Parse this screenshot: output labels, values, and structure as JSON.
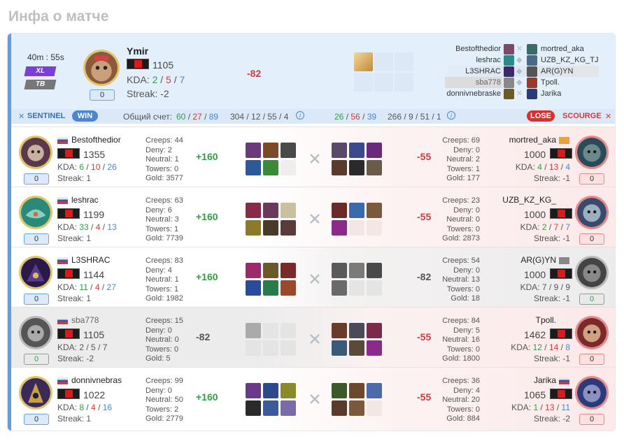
{
  "page_title": "Инфа о матче",
  "match": {
    "duration": "40m : 55s",
    "tags": [
      "XL",
      "TB"
    ],
    "player": {
      "name": "Ymir",
      "mmr": "1105",
      "kda": {
        "k": "2",
        "d": "5",
        "a": "7"
      },
      "kda_label": "KDA:",
      "streak": "Streak: -2",
      "badge": "0"
    },
    "delta": "-82",
    "matchups": [
      {
        "left": "Bestofthedior",
        "right": "mortred_aka"
      },
      {
        "left": "leshrac",
        "right": "UZB_KZ_KG_TJ"
      },
      {
        "left": "L3SHRAC",
        "right": "AR(G)YN"
      },
      {
        "left": "sba778",
        "right": "Tpoll."
      },
      {
        "left": "donnivnebraske",
        "right": "Jarika"
      }
    ]
  },
  "bar": {
    "sentinel": "SENTINEL",
    "win": "WIN",
    "score_label": "Общий счет:",
    "left_score": {
      "a": "60",
      "b": "27",
      "c": "89"
    },
    "left_totals": "304 / 12 / 55 / 4",
    "right_score": {
      "a": "26",
      "b": "56",
      "c": "39"
    },
    "right_totals": "266 / 9 / 51 / 1",
    "lose": "LOSE",
    "scourge": "SCOURGE"
  },
  "rows": [
    {
      "l": {
        "name": "Bestofthedior",
        "mmr": "1355",
        "k": "6",
        "d": "10",
        "a": "26",
        "streak": "Streak: 1",
        "badge": "0",
        "creeps": "Creeps: 44",
        "deny": "Deny: 2",
        "neutral": "Neutral: 1",
        "towers": "Towers: 0",
        "gold": "Gold: 3577",
        "delta": "+160"
      },
      "r": {
        "name": "mortred_aka",
        "mmr": "1000",
        "k": "4",
        "d": "13",
        "a": "4",
        "streak": "Streak: -1",
        "badge": "0",
        "creeps": "Creeps: 69",
        "deny": "Deny: 0",
        "neutral": "Neutral: 2",
        "towers": "Towers: 1",
        "gold": "Gold: 177",
        "delta": "-55"
      }
    },
    {
      "l": {
        "name": "leshrac",
        "mmr": "1199",
        "k": "33",
        "d": "4",
        "a": "13",
        "streak": "Streak: 1",
        "badge": "0",
        "creeps": "Creeps: 63",
        "deny": "Deny: 6",
        "neutral": "Neutral: 3",
        "towers": "Towers: 1",
        "gold": "Gold: 7739",
        "delta": "+160"
      },
      "r": {
        "name": "UZB_KZ_KG_",
        "mmr": "1000",
        "k": "2",
        "d": "7",
        "a": "7",
        "streak": "Streak: -1",
        "badge": "0",
        "creeps": "Creeps: 23",
        "deny": "Deny: 0",
        "neutral": "Neutral: 0",
        "towers": "Towers: 0",
        "gold": "Gold: 2873",
        "delta": "-55"
      }
    },
    {
      "l": {
        "name": "L3SHRAC",
        "mmr": "1144",
        "k": "11",
        "d": "4",
        "a": "27",
        "streak": "Streak: 1",
        "badge": "0",
        "creeps": "Creeps: 83",
        "deny": "Deny: 4",
        "neutral": "Neutral: 1",
        "towers": "Towers: 1",
        "gold": "Gold: 1982",
        "delta": "+160"
      },
      "r": {
        "name": "AR(G)YN",
        "mmr": "1000",
        "k": "7",
        "d": "9",
        "a": "9",
        "streak": "Streak: -1",
        "badge": "0",
        "creeps": "Creeps: 54",
        "deny": "Deny: 0",
        "neutral": "Neutral: 13",
        "towers": "Towers: 0",
        "gold": "Gold: 18",
        "delta": "-82"
      }
    },
    {
      "l": {
        "name": "sba778",
        "mmr": "1105",
        "k": "2",
        "d": "5",
        "a": "7",
        "streak": "Streak: -2",
        "badge": "0",
        "creeps": "Creeps: 15",
        "deny": "Deny: 0",
        "neutral": "Neutral: 0",
        "towers": "Towers: 0",
        "gold": "Gold: 5",
        "delta": "-82"
      },
      "r": {
        "name": "Tpoll.",
        "mmr": "1462",
        "k": "12",
        "d": "14",
        "a": "8",
        "streak": "Streak: -1",
        "badge": "0",
        "creeps": "Creeps: 84",
        "deny": "Deny: 5",
        "neutral": "Neutral: 16",
        "towers": "Towers: 0",
        "gold": "Gold: 1800",
        "delta": "-55"
      }
    },
    {
      "l": {
        "name": "donnivnebras",
        "mmr": "1022",
        "k": "8",
        "d": "4",
        "a": "16",
        "streak": "Streak: 1",
        "badge": "0",
        "creeps": "Creeps: 99",
        "deny": "Deny: 0",
        "neutral": "Neutral: 50",
        "towers": "Towers: 2",
        "gold": "Gold: 2779",
        "delta": "+160"
      },
      "r": {
        "name": "Jarika",
        "mmr": "1065",
        "k": "1",
        "d": "13",
        "a": "11",
        "streak": "Streak: -2",
        "badge": "0",
        "creeps": "Creeps: 36",
        "deny": "Deny: 4",
        "neutral": "Neutral: 20",
        "towers": "Towers: 0",
        "gold": "Gold: 884",
        "delta": "-55"
      }
    }
  ],
  "colors": {
    "accent": "#4a86d1",
    "win": "#2ea043",
    "loss": "#d23b3b",
    "sentinel_bg": "#e4effc"
  }
}
